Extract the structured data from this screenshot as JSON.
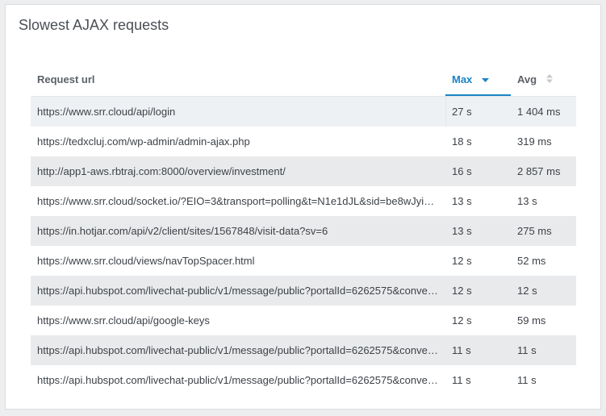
{
  "widget": {
    "title": "Slowest AJAX requests"
  },
  "table": {
    "columns": {
      "url": "Request url",
      "max": "Max",
      "avg": "Avg"
    },
    "sort": {
      "column": "max",
      "direction": "desc"
    },
    "rows": [
      {
        "url": "https://www.srr.cloud/api/login",
        "max": "27 s",
        "avg": "1 404 ms"
      },
      {
        "url": "https://tedxcluj.com/wp-admin/admin-ajax.php",
        "max": "18 s",
        "avg": "319 ms"
      },
      {
        "url": "http://app1-aws.rbtraj.com:8000/overview/investment/",
        "max": "16 s",
        "avg": "2 857 ms"
      },
      {
        "url": "https://www.srr.cloud/socket.io/?EIO=3&transport=polling&t=N1e1dJL&sid=be8wJyi…",
        "max": "13 s",
        "avg": "13 s"
      },
      {
        "url": "https://in.hotjar.com/api/v2/client/sites/1567848/visit-data?sv=6",
        "max": "13 s",
        "avg": "275 ms"
      },
      {
        "url": "https://www.srr.cloud/views/navTopSpacer.html",
        "max": "12 s",
        "avg": "52 ms"
      },
      {
        "url": "https://api.hubspot.com/livechat-public/v1/message/public?portalId=6262575&conve…",
        "max": "12 s",
        "avg": "12 s"
      },
      {
        "url": "https://www.srr.cloud/api/google-keys",
        "max": "12 s",
        "avg": "59 ms"
      },
      {
        "url": "https://api.hubspot.com/livechat-public/v1/message/public?portalId=6262575&conve…",
        "max": "11 s",
        "avg": "11 s"
      },
      {
        "url": "https://api.hubspot.com/livechat-public/v1/message/public?portalId=6262575&conve…",
        "max": "11 s",
        "avg": "11 s"
      }
    ]
  },
  "colors": {
    "accent": "#1a84c7",
    "row_shade": "#e9eaeb"
  },
  "icons": {
    "max_sort": "sort-desc-icon",
    "avg_sort": "sort-both-icon"
  }
}
